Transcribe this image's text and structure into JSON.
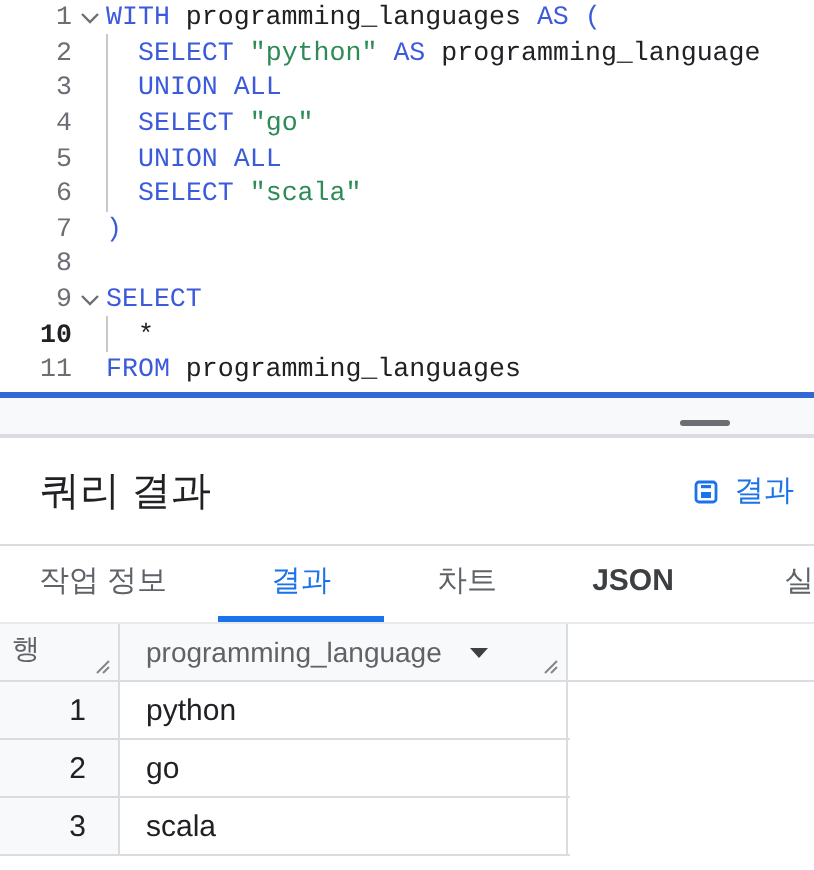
{
  "editor": {
    "lines": [
      {
        "number": "1",
        "foldable": true,
        "current": false,
        "guide": false,
        "tokens": [
          {
            "kind": "keyword",
            "text": "WITH"
          },
          {
            "kind": "plain",
            "text": " programming_languages "
          },
          {
            "kind": "keyword",
            "text": "AS"
          },
          {
            "kind": "punct",
            "text": " ("
          }
        ]
      },
      {
        "number": "2",
        "foldable": false,
        "current": false,
        "guide": true,
        "tokens": [
          {
            "kind": "keyword",
            "text": "SELECT"
          },
          {
            "kind": "string",
            "text": " \"python\""
          },
          {
            "kind": "keyword",
            "text": " AS"
          },
          {
            "kind": "plain",
            "text": " programming_language"
          }
        ]
      },
      {
        "number": "3",
        "foldable": false,
        "current": false,
        "guide": true,
        "tokens": [
          {
            "kind": "keyword",
            "text": "UNION ALL"
          }
        ]
      },
      {
        "number": "4",
        "foldable": false,
        "current": false,
        "guide": true,
        "tokens": [
          {
            "kind": "keyword",
            "text": "SELECT"
          },
          {
            "kind": "string",
            "text": " \"go\""
          }
        ]
      },
      {
        "number": "5",
        "foldable": false,
        "current": false,
        "guide": true,
        "tokens": [
          {
            "kind": "keyword",
            "text": "UNION ALL"
          }
        ]
      },
      {
        "number": "6",
        "foldable": false,
        "current": false,
        "guide": true,
        "tokens": [
          {
            "kind": "keyword",
            "text": "SELECT"
          },
          {
            "kind": "string",
            "text": " \"scala\""
          }
        ]
      },
      {
        "number": "7",
        "foldable": false,
        "current": false,
        "guide": false,
        "tokens": [
          {
            "kind": "punct",
            "text": ")"
          }
        ]
      },
      {
        "number": "8",
        "foldable": false,
        "current": false,
        "guide": false
      },
      {
        "number": "9",
        "foldable": true,
        "current": false,
        "guide": false,
        "tokens": [
          {
            "kind": "keyword",
            "text": "SELECT"
          }
        ]
      },
      {
        "number": "10",
        "foldable": false,
        "current": true,
        "guide": true,
        "tokens": [
          {
            "kind": "plain",
            "text": "*"
          }
        ]
      },
      {
        "number": "11",
        "foldable": false,
        "current": false,
        "guide": false,
        "tokens": [
          {
            "kind": "keyword",
            "text": "FROM"
          },
          {
            "kind": "plain",
            "text": " programming_languages"
          }
        ]
      }
    ]
  },
  "results": {
    "title": "쿼리 결과",
    "save_button": "결과",
    "tabs": [
      {
        "label": "작업 정보",
        "selected": false
      },
      {
        "label": "결과",
        "selected": true
      },
      {
        "label": "차트",
        "selected": false
      },
      {
        "label": "JSON",
        "selected": false
      },
      {
        "label": "실",
        "selected": false
      }
    ],
    "table": {
      "columns": [
        "행",
        "programming_language"
      ],
      "rows": [
        [
          "1",
          "python"
        ],
        [
          "2",
          "go"
        ],
        [
          "3",
          "scala"
        ]
      ]
    }
  }
}
